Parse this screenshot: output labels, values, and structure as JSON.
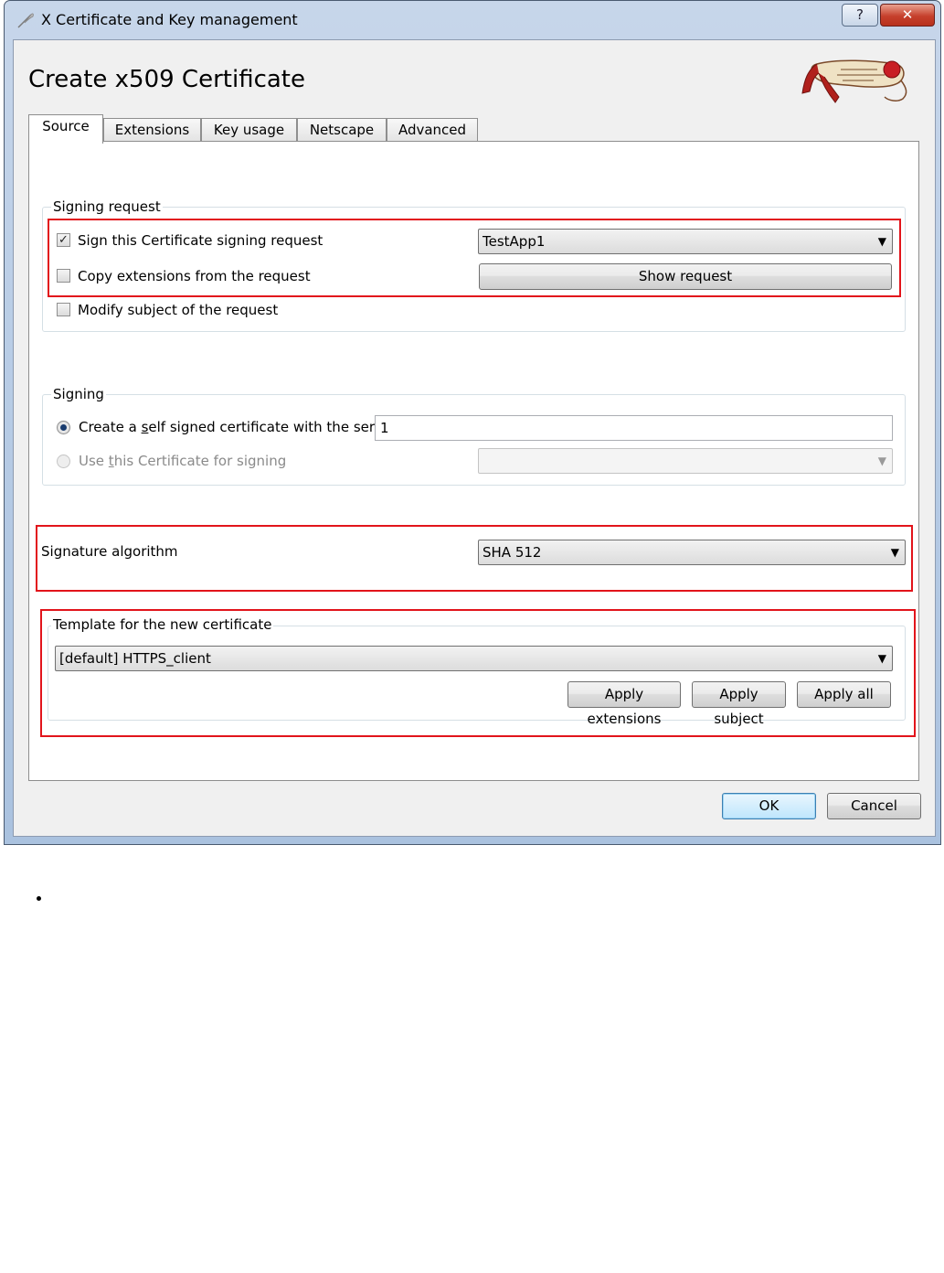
{
  "window": {
    "title": "X Certificate and Key management",
    "help_label": "?",
    "close_label": "✕"
  },
  "dialog": {
    "heading": "Create x509 Certificate"
  },
  "tabs": [
    {
      "label": "Source",
      "active": true
    },
    {
      "label": "Extensions",
      "active": false
    },
    {
      "label": "Key usage",
      "active": false
    },
    {
      "label": "Netscape",
      "active": false
    },
    {
      "label": "Advanced",
      "active": false
    }
  ],
  "signing_request": {
    "group_title": "Signing request",
    "sign_csr": {
      "label": "Sign this Certificate signing request",
      "checked": true
    },
    "csr_select": {
      "value": "TestApp1"
    },
    "copy_extensions": {
      "label": "Copy extensions from the request",
      "checked": false
    },
    "show_request_label": "Show request",
    "modify_subject": {
      "label": "Modify subject of the request",
      "checked": false
    }
  },
  "signing": {
    "group_title": "Signing",
    "self_signed": {
      "label": "Create a self signed certificate with the serial",
      "selected": true
    },
    "serial_value": "1",
    "use_cert": {
      "label": "Use this Certificate for signing",
      "selected": false,
      "disabled": true
    },
    "cert_select": {
      "value": ""
    }
  },
  "signature_algorithm": {
    "label": "Signature algorithm",
    "value": "SHA 512"
  },
  "template": {
    "group_title": "Template for the new certificate",
    "value": "[default] HTTPS_client",
    "apply_extensions_label": "Apply extensions",
    "apply_subject_label": "Apply subject",
    "apply_all_label": "Apply all"
  },
  "footer": {
    "ok_label": "OK",
    "cancel_label": "Cancel"
  },
  "colors": {
    "highlight": "#e2141b",
    "window_frame": "#b9cde6",
    "close_button": "#c6402c"
  }
}
